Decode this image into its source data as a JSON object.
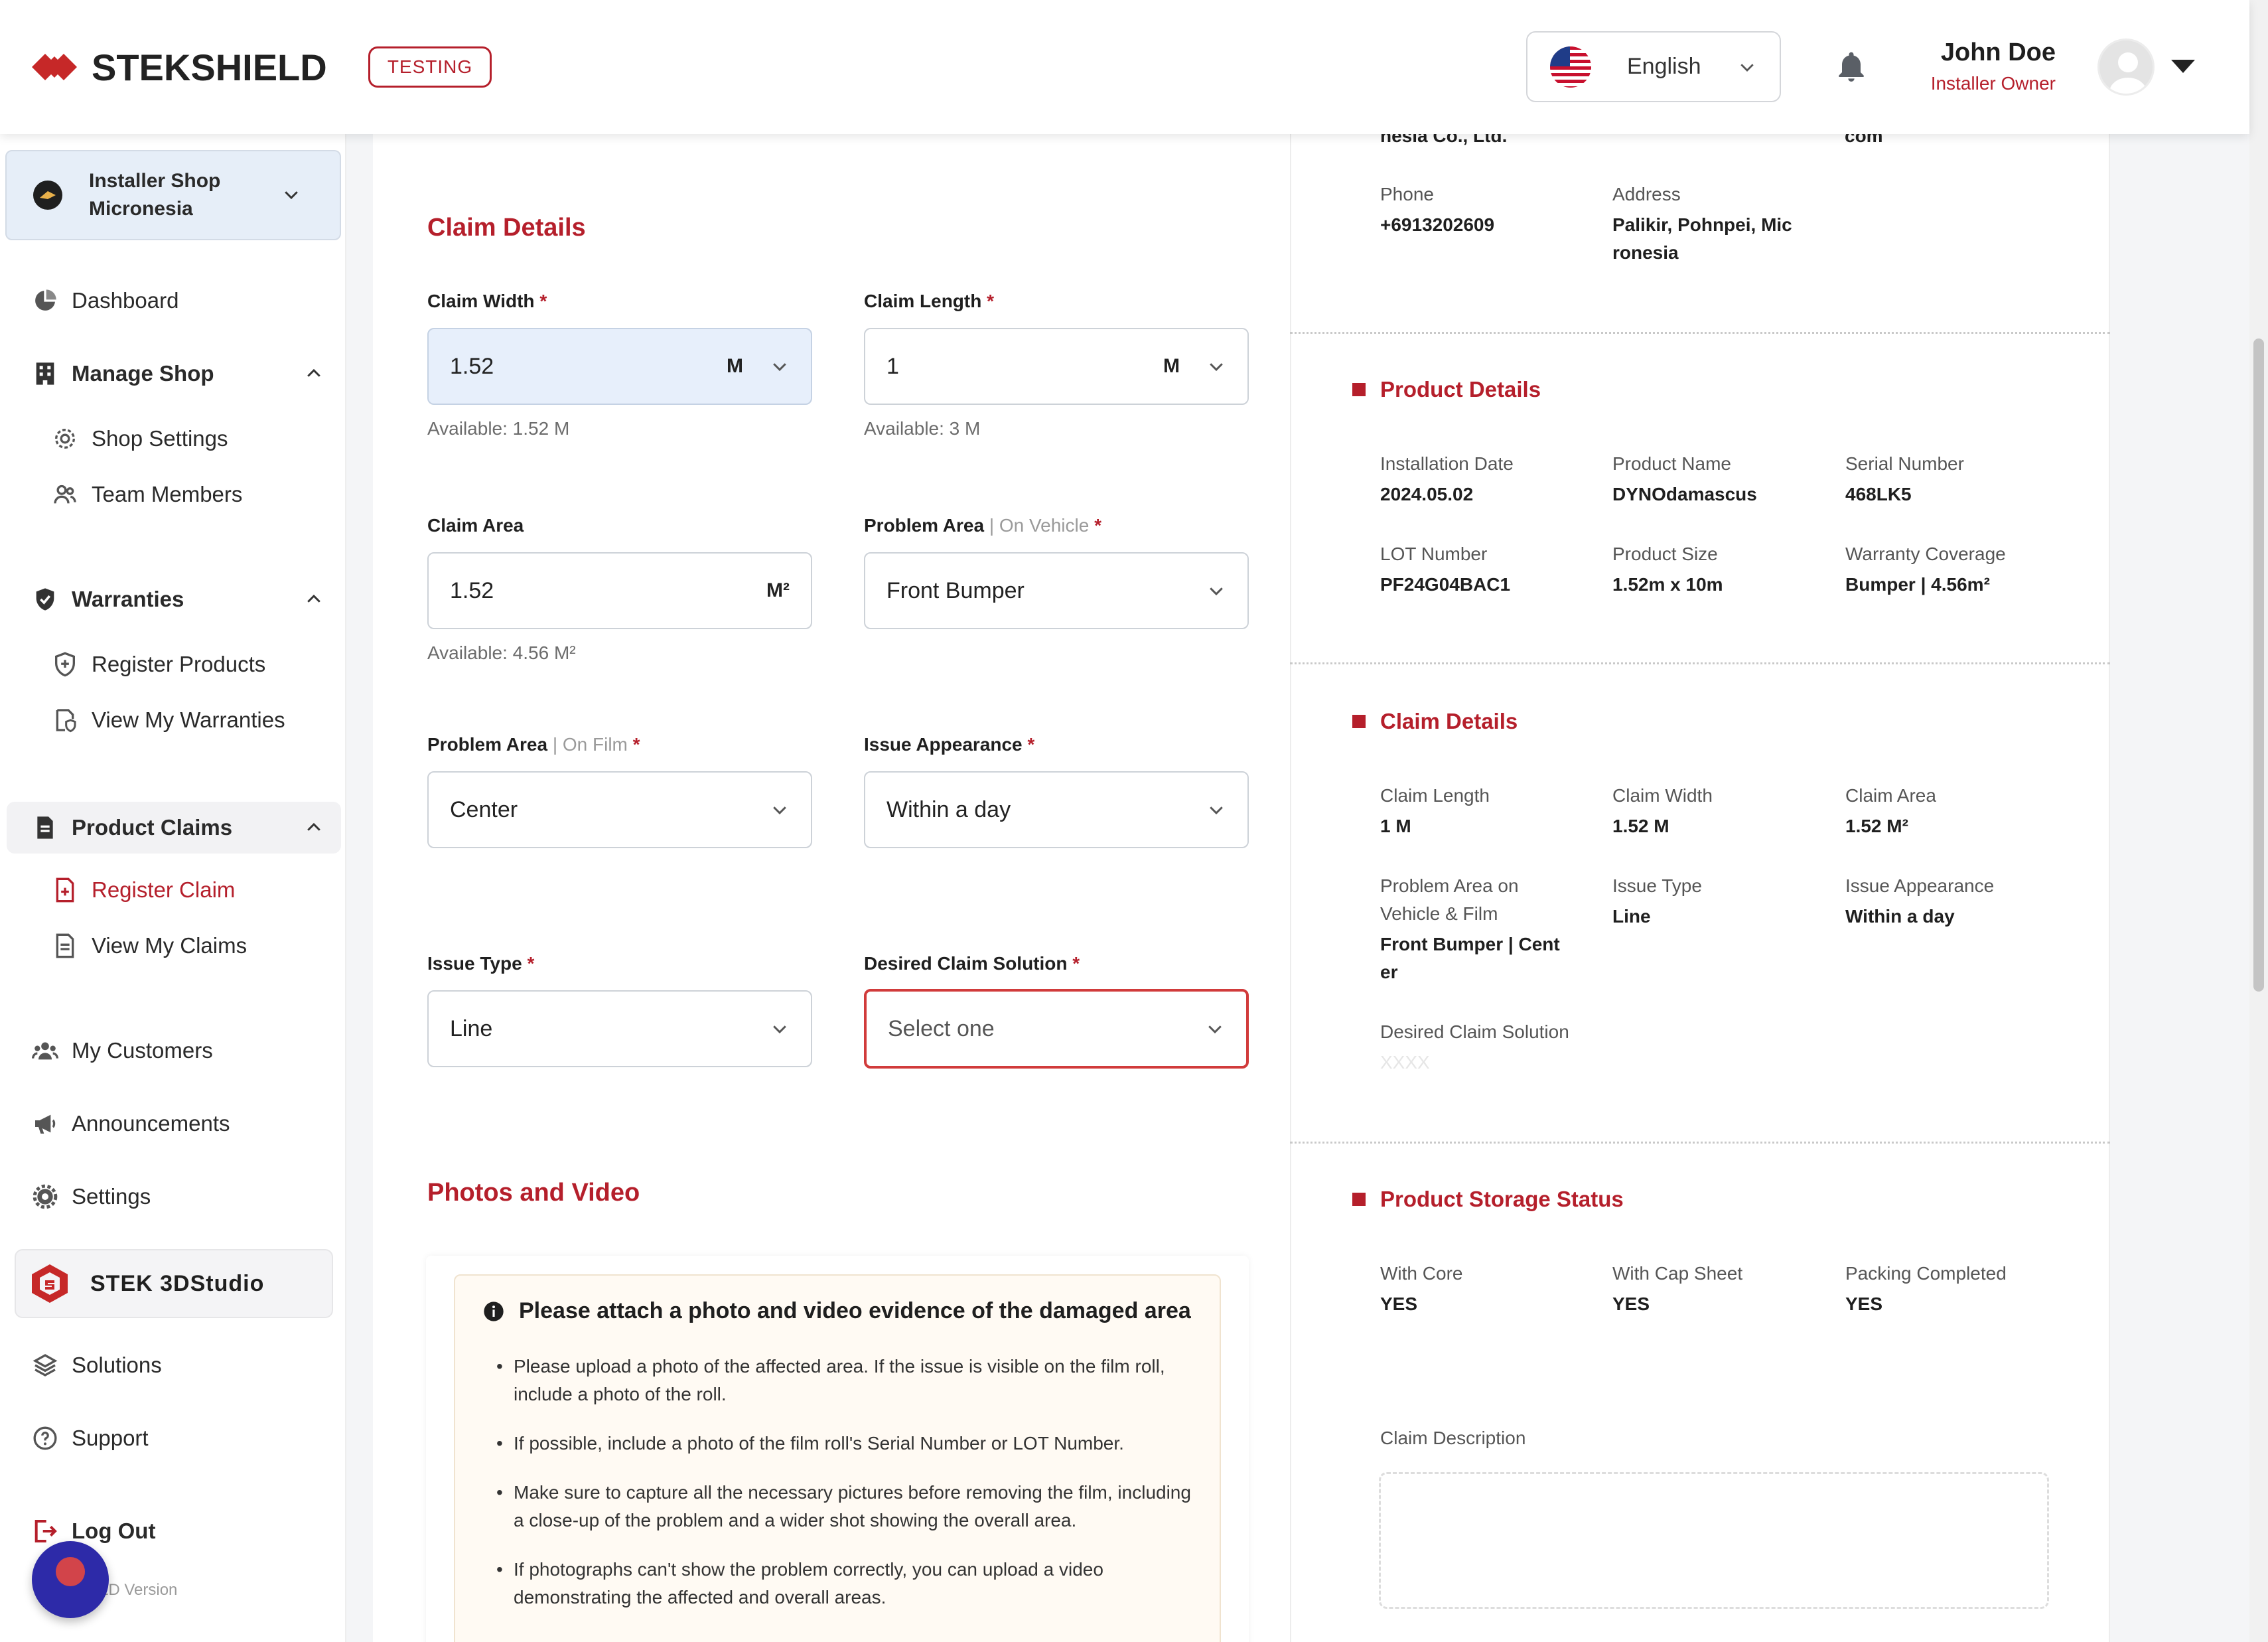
{
  "header": {
    "brand": "STEKSHIELD",
    "env_badge": "TESTING",
    "language": "English",
    "user_name": "John Doe",
    "user_role": "Installer Owner"
  },
  "sidebar": {
    "shop_name": "Installer Shop Micronesia",
    "items": {
      "dashboard": "Dashboard",
      "manage_shop": "Manage Shop",
      "shop_settings": "Shop Settings",
      "team_members": "Team Members",
      "warranties": "Warranties",
      "register_products": "Register Products",
      "view_warranties": "View My Warranties",
      "product_claims": "Product Claims",
      "register_claim": "Register Claim",
      "view_claims": "View My Claims",
      "my_customers": "My Customers",
      "announcements": "Announcements",
      "settings": "Settings",
      "stek3d": "STEK 3DStudio",
      "solutions": "Solutions",
      "support": "Support",
      "logout": "Log Out"
    },
    "version": "LD Version"
  },
  "form": {
    "claim_details_title": "Claim Details",
    "claim_width": {
      "label": "Claim Width",
      "value": "1.52",
      "unit": "M",
      "available": "Available: 1.52 M"
    },
    "claim_length": {
      "label": "Claim Length",
      "value": "1",
      "unit": "M",
      "available": "Available: 3 M"
    },
    "claim_area": {
      "label": "Claim Area",
      "value": "1.52",
      "unit": "M²",
      "available": "Available: 4.56 M²"
    },
    "problem_vehicle": {
      "label": "Problem Area",
      "sub": "On Vehicle",
      "value": "Front Bumper"
    },
    "problem_film": {
      "label": "Problem Area",
      "sub": "On Film",
      "value": "Center"
    },
    "issue_appearance": {
      "label": "Issue Appearance",
      "value": "Within a day"
    },
    "issue_type": {
      "label": "Issue Type",
      "value": "Line"
    },
    "desired_solution": {
      "label": "Desired Claim Solution",
      "placeholder": "Select one"
    },
    "required_mark": "*",
    "separator": "|",
    "photos_title": "Photos and Video",
    "notice_title": "Please attach a photo and video evidence of the damaged area",
    "notice_items": [
      "Please upload a photo of the affected area. If the issue is visible on the film roll, include a photo of the roll.",
      "If possible, include a photo of the film roll's Serial Number or LOT Number.",
      "Make sure to capture all the necessary pictures before removing the film, including a close-up of the problem and a wider shot showing the overall area.",
      "If photographs can't show the problem correctly, you can upload a video demonstrating the affected and overall areas."
    ]
  },
  "summary": {
    "top_fragments": {
      "company": "nesia Co., Ltd.",
      "email": "com"
    },
    "phone": {
      "label": "Phone",
      "value": "+6913202609"
    },
    "address": {
      "label": "Address",
      "value_line1": "Palikir, Pohnpei, Mic",
      "value_line2": "ronesia"
    },
    "product_details_title": "Product Details",
    "installation_date": {
      "label": "Installation Date",
      "value": "2024.05.02"
    },
    "product_name": {
      "label": "Product Name",
      "value": "DYNOdamascus"
    },
    "serial_number": {
      "label": "Serial Number",
      "value": "468LK5"
    },
    "lot_number": {
      "label": "LOT Number",
      "value": "PF24G04BAC1"
    },
    "product_size": {
      "label": "Product Size",
      "value": "1.52m x 10m"
    },
    "warranty_coverage": {
      "label": "Warranty Coverage",
      "value": "Bumper | 4.56m²"
    },
    "claim_details_title": "Claim Details",
    "claim_length": {
      "label": "Claim Length",
      "value": "1 M"
    },
    "claim_width": {
      "label": "Claim Width",
      "value": "1.52 M"
    },
    "claim_area": {
      "label": "Claim Area",
      "value": "1.52 M²"
    },
    "problem_area": {
      "label_line1": "Problem Area on",
      "label_line2": "Vehicle & Film",
      "value_line1": "Front Bumper | Cent",
      "value_line2": "er"
    },
    "issue_type": {
      "label": "Issue Type",
      "value": "Line"
    },
    "issue_appearance": {
      "label": "Issue Appearance",
      "value": "Within a day"
    },
    "desired_solution": {
      "label": "Desired Claim Solution",
      "value": "XXXX"
    },
    "storage_title": "Product Storage Status",
    "with_core": {
      "label": "With Core",
      "value": "YES"
    },
    "with_cap_sheet": {
      "label": "With Cap Sheet",
      "value": "YES"
    },
    "packing_completed": {
      "label": "Packing Completed",
      "value": "YES"
    },
    "claim_description": {
      "label": "Claim Description"
    }
  },
  "colors": {
    "brand_red": "#b51f2b",
    "error_red": "#d13b3b",
    "field_blue": "#e7effb",
    "chat_bubble": "#2d2aa8"
  },
  "icons": [
    "brand-logo-icon",
    "us-flag-icon",
    "chevron-down-icon",
    "bell-icon",
    "avatar-icon",
    "caret-down-icon",
    "dashboard-icon",
    "building-icon",
    "gear-icon",
    "team-icon",
    "shield-check-icon",
    "shield-plus-icon",
    "warranty-file-icon",
    "document-icon",
    "document-plus-icon",
    "customers-icon",
    "megaphone-icon",
    "stek3d-logo-icon",
    "layers-icon",
    "question-icon",
    "logout-icon",
    "info-icon",
    "chat-icon"
  ]
}
